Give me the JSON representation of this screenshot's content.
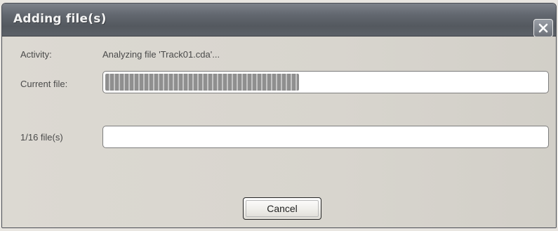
{
  "window": {
    "title": "Adding file(s)"
  },
  "fields": {
    "activity_label": "Activity:",
    "activity_value": "Analyzing file 'Track01.cda'...",
    "current_file_label": "Current file:",
    "file_count_label": "1/16 file(s)"
  },
  "progress": {
    "current_file_fraction": 0.44,
    "total_fraction": 0.0
  },
  "buttons": {
    "cancel_label": "Cancel",
    "close_icon": "close-icon"
  },
  "colors": {
    "titlebar": "#5e636b",
    "progress_fill": "#8f8f8f"
  }
}
